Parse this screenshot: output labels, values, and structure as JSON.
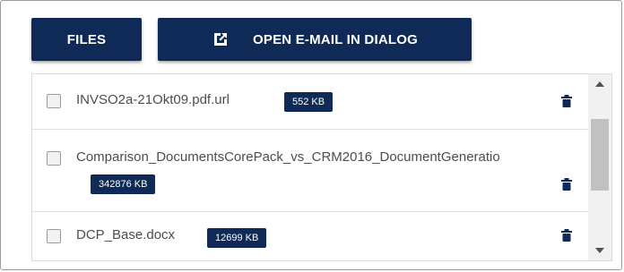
{
  "toolbar": {
    "files_label": "FILES",
    "open_email_label": "OPEN E-MAIL IN DIALOG",
    "open_email_icon": "external-link-icon"
  },
  "files": [
    {
      "name": "INVSO2a-21Okt09.pdf.url",
      "size": "552 KB"
    },
    {
      "name": "Comparison_DocumentsCorePack_vs_CRM2016_DocumentGeneratio",
      "size": "342876 KB"
    },
    {
      "name": "DCP_Base.docx",
      "size": "12699 KB"
    }
  ],
  "colors": {
    "primary": "#0f2a57",
    "text": "#4d4d4d"
  }
}
